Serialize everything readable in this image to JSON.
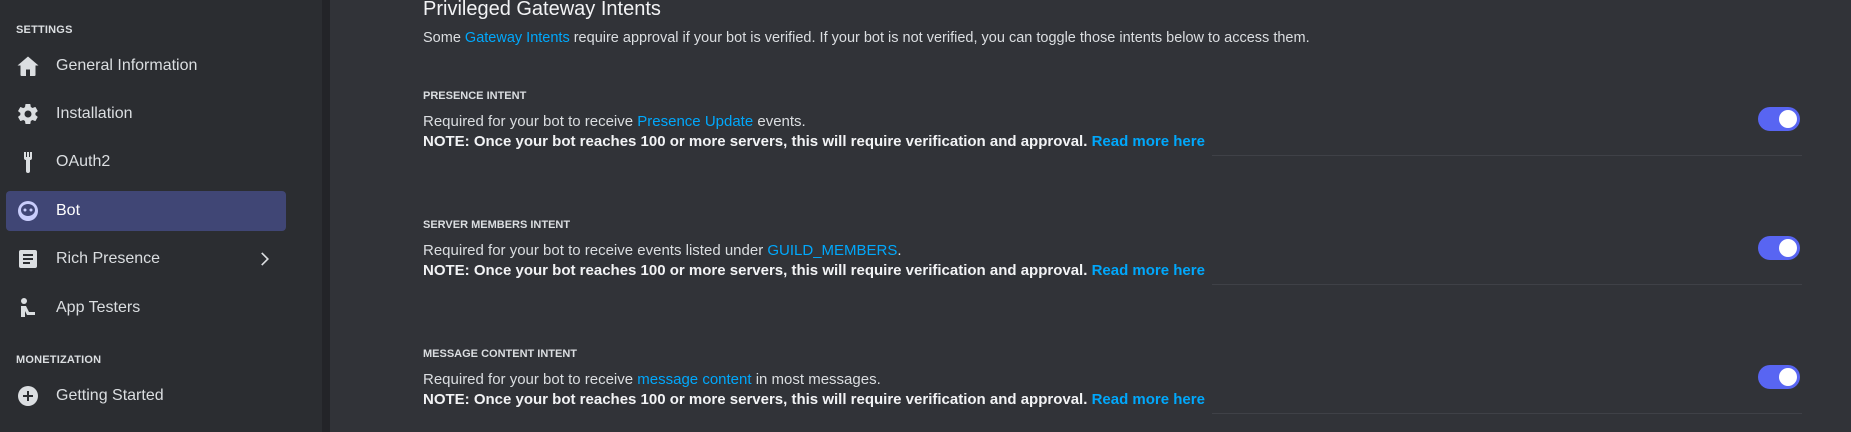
{
  "sidebar": {
    "settings_header": "SETTINGS",
    "items": [
      {
        "label": "General Information",
        "icon": "home-icon"
      },
      {
        "label": "Installation",
        "icon": "gear-icon"
      },
      {
        "label": "OAuth2",
        "icon": "wrench-icon"
      },
      {
        "label": "Bot",
        "icon": "bot-icon",
        "active": true
      },
      {
        "label": "Rich Presence",
        "icon": "document-icon",
        "has_chevron": true
      },
      {
        "label": "App Testers",
        "icon": "person-icon"
      }
    ],
    "monetization_header": "MONETIZATION",
    "monetization_items": [
      {
        "label": "Getting Started",
        "icon": "plus-circle-icon"
      }
    ]
  },
  "main": {
    "title": "Privileged Gateway Intents",
    "desc_prefix": "Some ",
    "desc_link": "Gateway Intents",
    "desc_suffix": " require approval if your bot is verified. If your bot is not verified, you can toggle those intents below to access them.",
    "intents": [
      {
        "title": "PRESENCE INTENT",
        "line_prefix": "Required for your bot to receive ",
        "line_link": "Presence Update",
        "line_suffix": " events.",
        "note": "NOTE: Once your bot reaches 100 or more servers, this will require verification and approval.",
        "read_more": "Read more here",
        "enabled": true
      },
      {
        "title": "SERVER MEMBERS INTENT",
        "line_prefix": "Required for your bot to receive events listed under ",
        "line_link": "GUILD_MEMBERS",
        "line_suffix": ".",
        "note": "NOTE: Once your bot reaches 100 or more servers, this will require verification and approval.",
        "read_more": "Read more here",
        "enabled": true
      },
      {
        "title": "MESSAGE CONTENT INTENT",
        "line_prefix": "Required for your bot to receive ",
        "line_link": "message content",
        "line_suffix": " in most messages.",
        "note": "NOTE: Once your bot reaches 100 or more servers, this will require verification and approval.",
        "read_more": "Read more here",
        "enabled": true
      }
    ]
  },
  "colors": {
    "accent": "#5865f2",
    "link": "#00a8fc",
    "active_nav": "#404675",
    "background": "#313338",
    "sidebar": "#2b2d31"
  }
}
